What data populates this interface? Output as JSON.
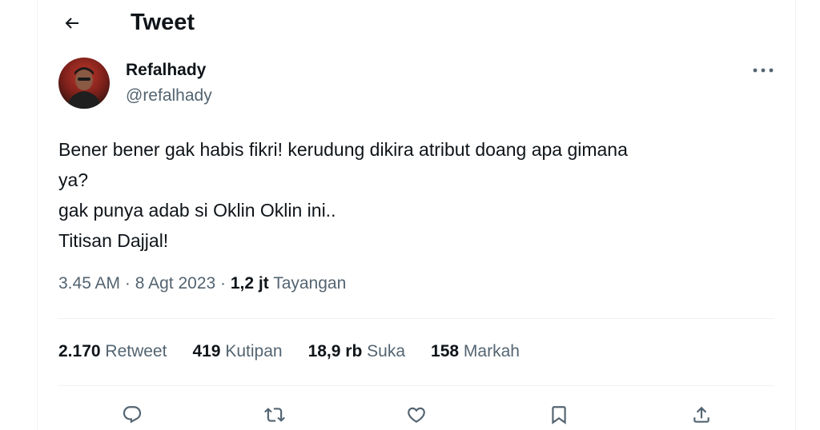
{
  "header": {
    "title": "Tweet",
    "back_icon": "arrow-left-icon"
  },
  "author": {
    "display_name": "Refalhady",
    "handle": "@refalhady",
    "more_icon": "more-horizontal-icon"
  },
  "tweet": {
    "lines": [
      "Bener bener gak habis fikri! kerudung dikira atribut doang apa gimana",
      "ya?",
      "gak punya adab si Oklin Oklin ini..",
      "Titisan Dajjal!"
    ],
    "time": "3.45 AM",
    "separator": "·",
    "date": "8 Agt 2023",
    "views_count": "1,2 jt",
    "views_label": "Tayangan"
  },
  "stats": {
    "retweets_count": "2.170",
    "retweets_label": "Retweet",
    "quotes_count": "419",
    "quotes_label": "Kutipan",
    "likes_count": "18,9 rb",
    "likes_label": "Suka",
    "bookmarks_count": "158",
    "bookmarks_label": "Markah"
  },
  "actions": {
    "icons": [
      "reply-icon",
      "retweet-icon",
      "like-icon",
      "bookmark-icon",
      "share-icon"
    ]
  },
  "colors": {
    "text_primary": "#0f1419",
    "text_secondary": "#536471",
    "divider": "#eff3f4"
  }
}
